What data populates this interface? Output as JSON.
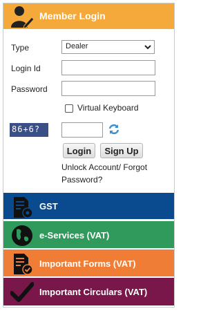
{
  "header": {
    "title": "Member Login",
    "icon": "user-pencil-icon",
    "color": "#f5a93a"
  },
  "form": {
    "type_label": "Type",
    "type_value": "Dealer",
    "login_label": "Login Id",
    "login_value": "",
    "password_label": "Password",
    "password_value": "",
    "virtual_keyboard_label": "Virtual Keyboard",
    "virtual_keyboard_checked": false,
    "captcha_text": "86+6?",
    "captcha_value": "",
    "login_button": "Login",
    "signup_button": "Sign Up",
    "unlock_link": "Unlock Account/ Forgot",
    "unlock_link_2": "Password?"
  },
  "menu": [
    {
      "label": "GST",
      "icon": "document-gear-icon",
      "color": "#0a4a8f"
    },
    {
      "label": "e-Services (VAT)",
      "icon": "globe-icon",
      "color": "#2f9a5b"
    },
    {
      "label": "Important Forms (VAT)",
      "icon": "document-check-icon",
      "color": "#ef7d35"
    },
    {
      "label": "Important Circulars (VAT)",
      "icon": "checkmark-icon",
      "color": "#7a174a"
    }
  ]
}
